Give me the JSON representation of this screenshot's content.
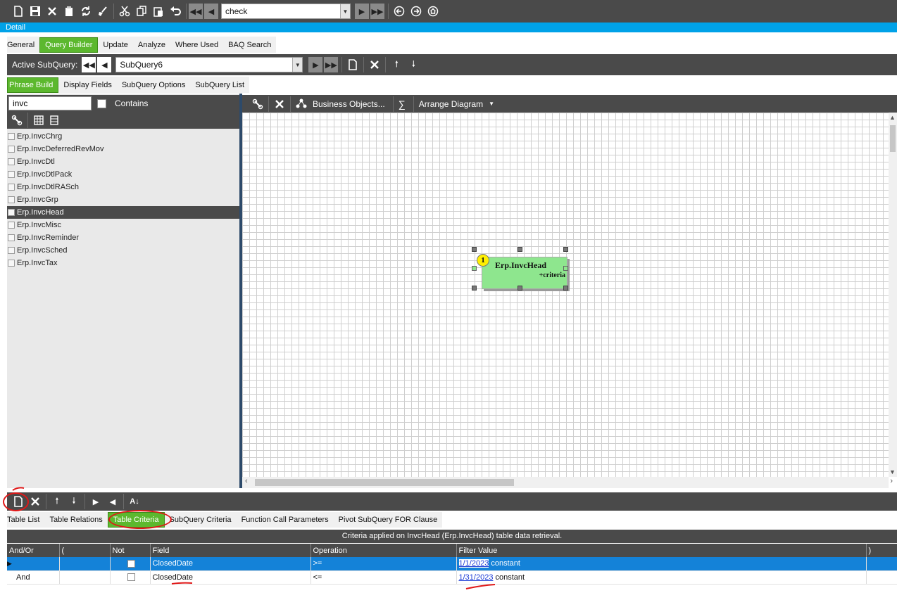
{
  "toolbar": {
    "icons": [
      "new-icon",
      "save-icon",
      "delete-icon",
      "clear-icon",
      "refresh-icon",
      "broom-icon",
      "cut-icon",
      "copy-icon",
      "paste-icon",
      "undo-icon"
    ],
    "search_value": "check"
  },
  "detail_label": "Detail",
  "main_tabs": [
    "General",
    "Query Builder",
    "Update",
    "Analyze",
    "Where Used",
    "BAQ Search"
  ],
  "main_tabs_active": "Query Builder",
  "subquery": {
    "label": "Active SubQuery:",
    "value": "SubQuery6"
  },
  "sub_tabs": [
    "Phrase Build",
    "Display Fields",
    "SubQuery Options",
    "SubQuery List"
  ],
  "sub_tabs_active": "Phrase Build",
  "left_panel": {
    "filter_value": "invc",
    "contains_label": "Contains",
    "contains_checked": false,
    "tables": [
      "Erp.InvcChrg",
      "Erp.InvcDeferredRevMov",
      "Erp.InvcDtl",
      "Erp.InvcDtlPack",
      "Erp.InvcDtlRASch",
      "Erp.InvcGrp",
      "Erp.InvcHead",
      "Erp.InvcMisc",
      "Erp.InvcReminder",
      "Erp.InvcSched",
      "Erp.InvcTax"
    ],
    "selected_table": "Erp.InvcHead"
  },
  "diagram_toolbar": {
    "business_objects": "Business Objects...",
    "sigma": "∑",
    "arrange": "Arrange Diagram"
  },
  "diagram_node": {
    "number": "1",
    "name": "Erp.InvcHead",
    "criteria": "+criteria"
  },
  "bottom_tabs": [
    "Table List",
    "Table Relations",
    "Table Criteria",
    "SubQuery Criteria",
    "Function Call Parameters",
    "Pivot SubQuery FOR Clause"
  ],
  "bottom_tabs_active": "Table Criteria",
  "criteria_caption": "Criteria applied on InvcHead (Erp.InvcHead) table data retrieval.",
  "grid": {
    "headers": [
      "And/Or",
      "(",
      "Not",
      "Field",
      "Operation",
      "Filter Value",
      ")"
    ],
    "rows": [
      {
        "and_or": "",
        "open": "",
        "not": false,
        "field": "ClosedDate",
        "operation": ">=",
        "filter_value": "1/1/2023",
        "filter_kind": "constant",
        "selected": true
      },
      {
        "and_or": "And",
        "open": "",
        "not": false,
        "field": "ClosedDate",
        "operation": "<=",
        "filter_value": "1/31/2023",
        "filter_kind": "constant",
        "selected": false
      }
    ]
  },
  "colors": {
    "accent_blue": "#00a2e8",
    "active_tab_green": "#5cb82e",
    "toolbar_gray": "#4a4a4a",
    "node_green": "#8ee68e",
    "annotation_red": "#e01818"
  }
}
